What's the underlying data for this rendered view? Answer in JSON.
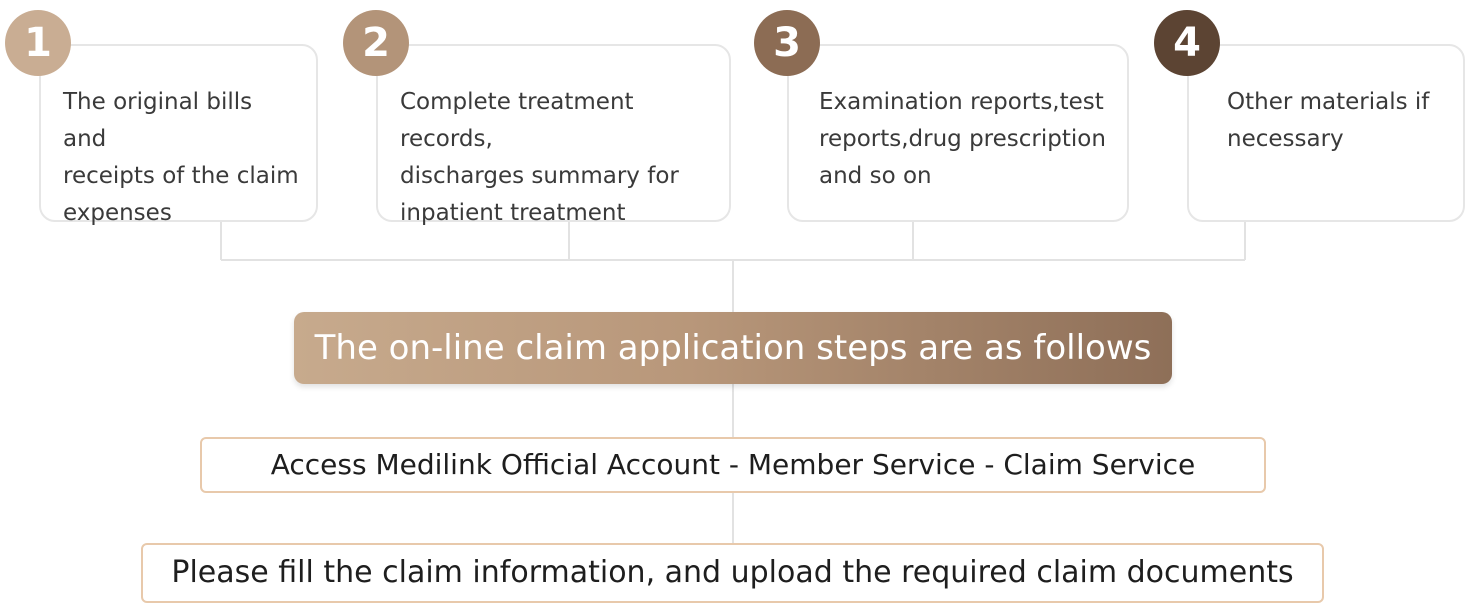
{
  "requirements": [
    {
      "number": "1",
      "text": "The original bills and\nreceipts of the claim\nexpenses",
      "badge_color": "#c9ad93"
    },
    {
      "number": "2",
      "text": "Complete treatment records,\ndischarges summary for\ninpatient treatment",
      "badge_color": "#b39479"
    },
    {
      "number": "3",
      "text": "Examination reports,test\nreports,drug prescription\nand so on",
      "badge_color": "#8c6c54"
    },
    {
      "number": "4",
      "text": "Other materials if\nnecessary",
      "badge_color": "#5c4433"
    }
  ],
  "banner": {
    "title": "The on-line claim application steps are as follows"
  },
  "steps": [
    {
      "text": "Access Medilink Official Account - Member Service -  Claim Service"
    },
    {
      "text": "Please fill the claim information, and upload the required claim documents"
    }
  ],
  "colors": {
    "connector": "#e2e2e2",
    "step_border": "#e8c9ab",
    "banner_start": "#c7aa8d",
    "banner_end": "#8e6f58"
  }
}
